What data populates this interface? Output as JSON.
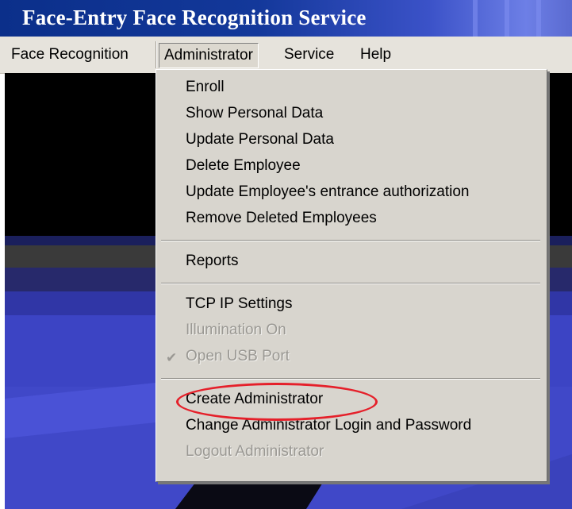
{
  "window": {
    "title": "Face-Entry Face Recognition Service"
  },
  "menubar": {
    "items": [
      {
        "label": "Face Recognition"
      },
      {
        "label": "Administrator"
      },
      {
        "label": "Service"
      },
      {
        "label": "Help"
      }
    ]
  },
  "administrator_menu": {
    "groups": [
      [
        "Enroll",
        "Show Personal Data",
        "Update Personal Data",
        "Delete Employee",
        "Update Employee's entrance authorization",
        "Remove Deleted Employees"
      ],
      [
        "Reports"
      ],
      [
        "TCP IP Settings",
        "Illumination On",
        "Open USB Port"
      ],
      [
        "Create Administrator",
        "Change Administrator Login and Password",
        "Logout Administrator"
      ]
    ],
    "disabled": [
      "Illumination On",
      "Open USB Port",
      "Logout Administrator"
    ],
    "checked": [
      "Open USB Port"
    ],
    "highlighted": "Create Administrator",
    "highlight_color": "#e5202a"
  },
  "colors": {
    "titlebar": "#0b2f8a",
    "menubar": "#e6e3dc",
    "menu_bg": "#d8d5ce",
    "background": "#000000",
    "preview_blue": "#4048c8"
  },
  "icons": {
    "check": "check-icon"
  }
}
